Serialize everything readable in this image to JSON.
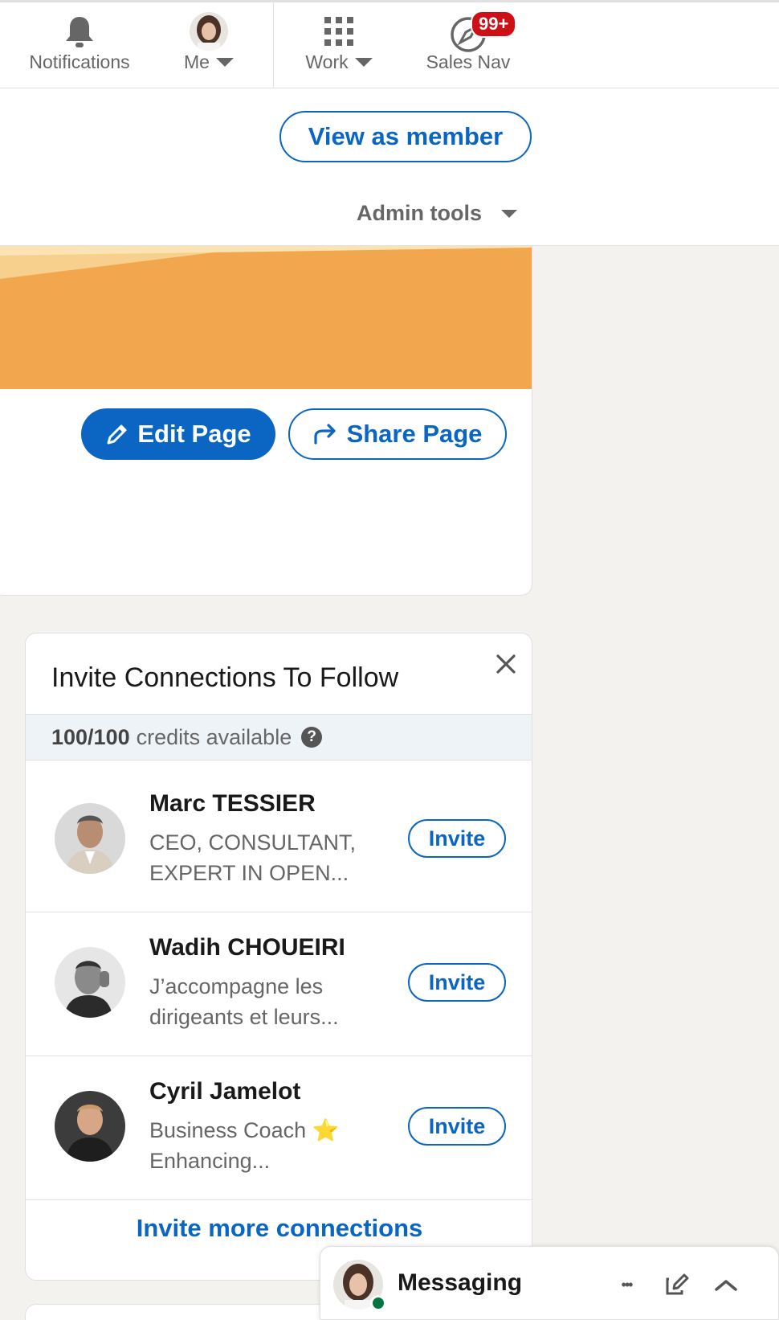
{
  "nav": {
    "notifications_label": "Notifications",
    "me_label": "Me",
    "work_label": "Work",
    "sales_nav_label": "Sales Nav",
    "sales_nav_badge": "99+"
  },
  "header": {
    "view_as_member": "View as member",
    "admin_tools": "Admin tools"
  },
  "page_actions": {
    "edit_page": "Edit Page",
    "share_page": "Share Page"
  },
  "invite": {
    "title": "Invite Connections To Follow",
    "credits_count": "100/100",
    "credits_text": "credits available",
    "help_glyph": "?",
    "people": [
      {
        "name": "Marc TESSIER",
        "desc": "CEO, CONSULTANT, EXPERT IN OPEN...",
        "button": "Invite"
      },
      {
        "name": "Wadih CHOUEIRI",
        "desc": "J’accompagne les dirigeants et leurs...",
        "button": "Invite"
      },
      {
        "name": "Cyril Jamelot",
        "desc": "Business Coach ⭐ Enhancing...",
        "button": "Invite"
      }
    ],
    "invite_more": "Invite more connections"
  },
  "messaging": {
    "label": "Messaging",
    "more_glyph": "•••"
  },
  "colors": {
    "brand_blue": "#0a66c2",
    "cover_orange": "#f2a74e",
    "badge_red": "#cc1016",
    "online_green": "#057642"
  }
}
